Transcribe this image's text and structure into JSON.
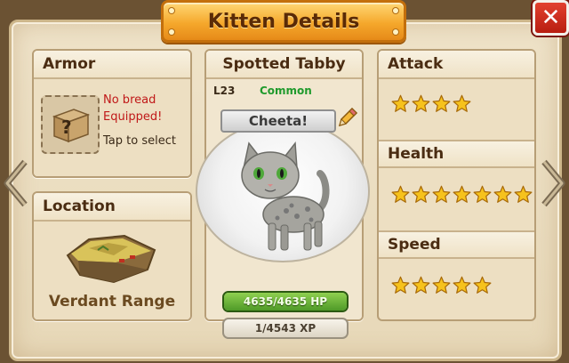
{
  "title": "Kitten Details",
  "close_label": "✕",
  "armor": {
    "header": "Armor",
    "slot_symbol": "?",
    "warning_line1": "No bread",
    "warning_line2": "Equipped!",
    "hint": "Tap to select"
  },
  "location": {
    "header": "Location",
    "name": "Verdant Range"
  },
  "kitten": {
    "breed": "Spotted Tabby",
    "level": "L23",
    "rarity": "Common",
    "nickname": "Cheeta!",
    "hp_text": "4635/4635 HP",
    "hp_fraction": 1.0,
    "xp_text": "1/4543 XP"
  },
  "stats": [
    {
      "label": "Attack",
      "stars": 4
    },
    {
      "label": "Health",
      "stars": 7
    },
    {
      "label": "Speed",
      "stars": 5
    }
  ],
  "colors": {
    "star_fill": "#f6c21c",
    "star_stroke": "#a86a08",
    "rarity": "#1f9a2c",
    "warning": "#c01818"
  }
}
